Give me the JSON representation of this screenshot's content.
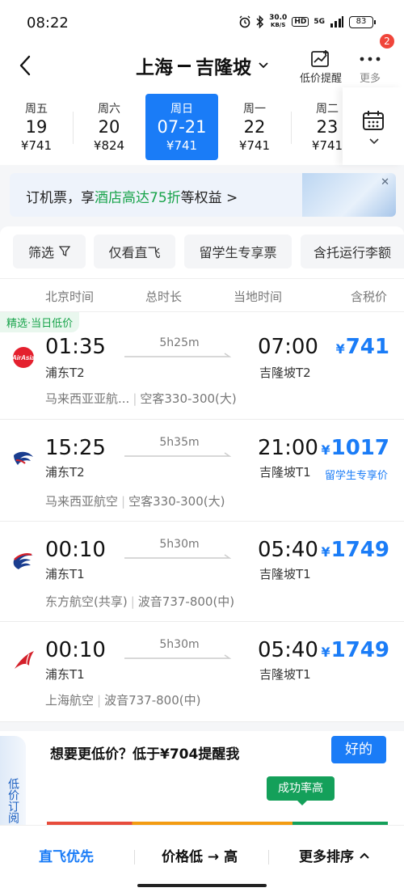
{
  "status": {
    "time": "08:22",
    "speed": "30.0",
    "speed_unit": "KB/S",
    "hd": "HD",
    "net": "5G",
    "battery": "83"
  },
  "header": {
    "from": "上海",
    "to": "吉隆坡",
    "alert_label": "低价提醒",
    "more_label": "更多",
    "badge": "2"
  },
  "dates": [
    {
      "weekday": "周五",
      "date": "19",
      "price": "¥741",
      "selected": false
    },
    {
      "weekday": "周六",
      "date": "20",
      "price": "¥824",
      "selected": false
    },
    {
      "weekday": "周日",
      "date": "07-21",
      "price": "¥741",
      "selected": true
    },
    {
      "weekday": "周一",
      "date": "22",
      "price": "¥741",
      "selected": false
    },
    {
      "weekday": "周二",
      "date": "23",
      "price": "¥741",
      "selected": false
    }
  ],
  "promo": {
    "prefix": "订机票，享",
    "highlight": "酒店高达75折",
    "suffix": "等权益 >"
  },
  "filters": [
    "筛选",
    "仅看直飞",
    "留学生专享票",
    "含托运行李额"
  ],
  "columns": {
    "depart": "北京时间",
    "duration": "总时长",
    "arrive": "当地时间",
    "price": "含税价"
  },
  "flights": [
    {
      "tag": "精选·当日低价",
      "dep_time": "01:35",
      "dep_term": "浦东T2",
      "duration": "5h25m",
      "arr_time": "07:00",
      "arr_term": "吉隆坡T2",
      "currency": "¥",
      "price": "741",
      "sub_price": "",
      "airline": "马来西亚亚航...",
      "aircraft": "空客330-300(大)",
      "logo": "airasia-logo"
    },
    {
      "tag": "",
      "dep_time": "15:25",
      "dep_term": "浦东T2",
      "duration": "5h35m",
      "arr_time": "21:00",
      "arr_term": "吉隆坡T1",
      "currency": "¥",
      "price": "1017",
      "sub_price": "留学生专享价",
      "airline": "马来西亚航空",
      "aircraft": "空客330-300(大)",
      "logo": "malaysia-airlines-logo"
    },
    {
      "tag": "",
      "dep_time": "00:10",
      "dep_term": "浦东T1",
      "duration": "5h30m",
      "arr_time": "05:40",
      "arr_term": "吉隆坡T1",
      "currency": "¥",
      "price": "1749",
      "sub_price": "",
      "airline": "东方航空(共享)",
      "aircraft": "波音737-800(中)",
      "logo": "china-eastern-logo"
    },
    {
      "tag": "",
      "dep_time": "00:10",
      "dep_term": "浦东T1",
      "duration": "5h30m",
      "arr_time": "05:40",
      "arr_term": "吉隆坡T1",
      "currency": "¥",
      "price": "1749",
      "sub_price": "",
      "airline": "上海航空",
      "aircraft": "波音737-800(中)",
      "logo": "shanghai-airlines-logo"
    }
  ],
  "subscribe": {
    "side_label": "低价订阅",
    "text": "想要更低价？低于¥704提醒我",
    "button": "好的",
    "success_label": "成功率高"
  },
  "bottom": {
    "direct": "直飞优先",
    "sort_price": "价格低 → 高",
    "more_sort": "更多排序"
  },
  "colors": {
    "accent": "#1a7cf7",
    "green": "#14a05a",
    "red": "#f0453a"
  }
}
